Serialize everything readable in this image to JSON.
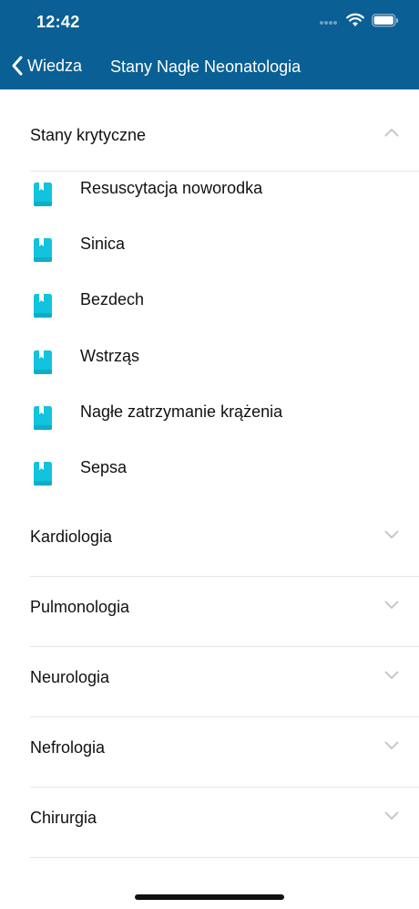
{
  "status_bar": {
    "time": "12:42"
  },
  "nav": {
    "back_label": "Wiedza",
    "title": "Stany Nagłe Neonatologia"
  },
  "expanded_section": {
    "title": "Stany krytyczne",
    "items": [
      {
        "label": "Resuscytacja noworodka"
      },
      {
        "label": "Sinica"
      },
      {
        "label": "Bezdech"
      },
      {
        "label": "Wstrząs"
      },
      {
        "label": "Nagłe zatrzymanie krążenia"
      },
      {
        "label": "Sepsa"
      }
    ]
  },
  "categories": [
    {
      "title": "Kardiologia"
    },
    {
      "title": "Pulmonologia"
    },
    {
      "title": "Neurologia"
    },
    {
      "title": "Nefrologia"
    },
    {
      "title": "Chirurgia"
    }
  ],
  "colors": {
    "header": "#0a5f94",
    "book_icon": "#11c3dc",
    "chevron": "#c7c7cc"
  }
}
